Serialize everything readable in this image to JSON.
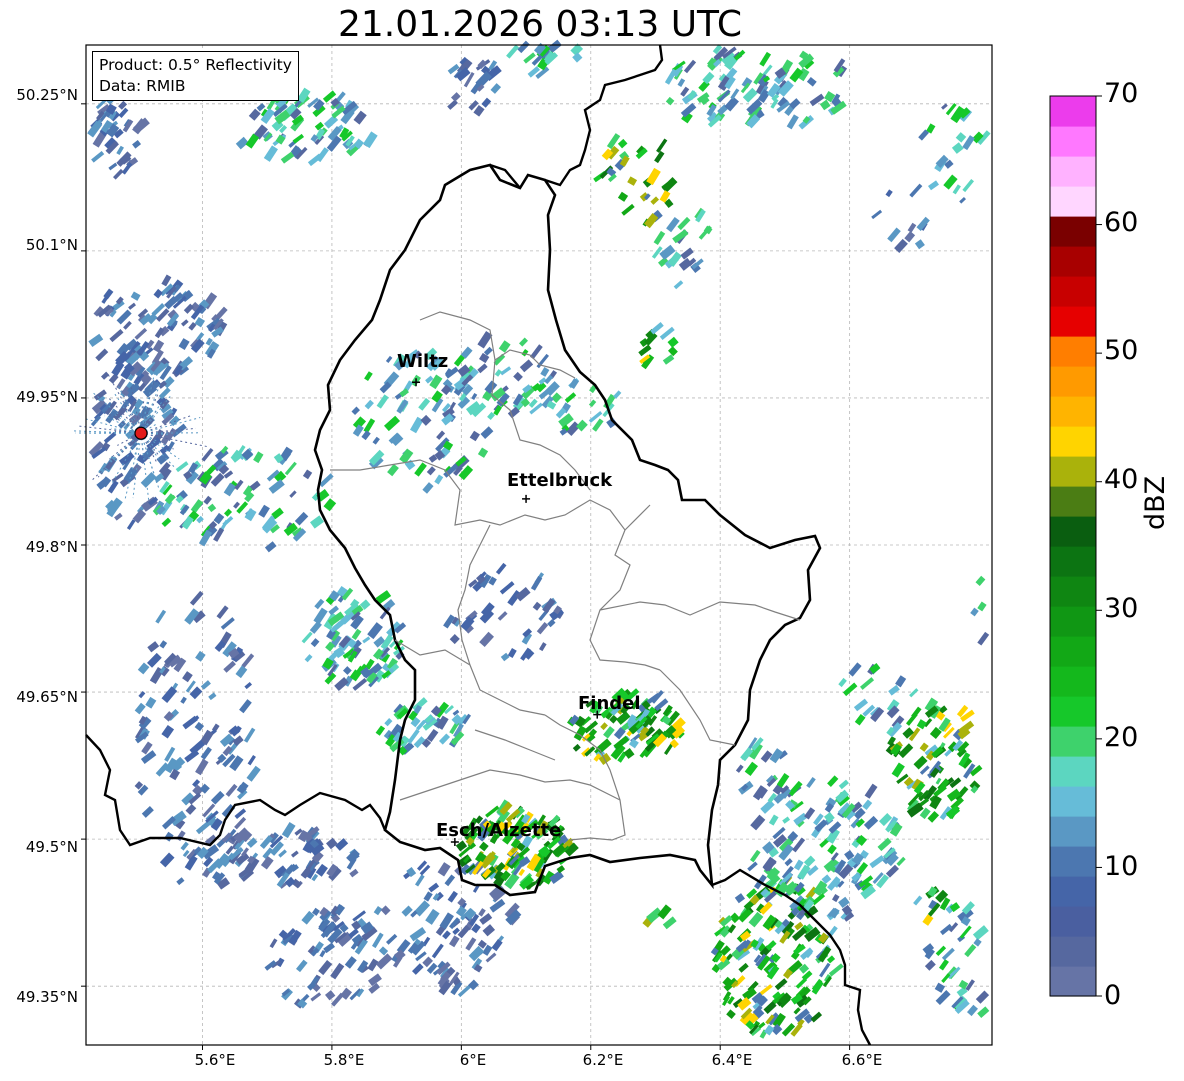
{
  "title": "21.01.2026 03:13 UTC",
  "info": {
    "product": "Product: 0.5° Reflectivity",
    "data": "Data: RMIB"
  },
  "map": {
    "lon_range": [
      5.42,
      6.82
    ],
    "lat_range": [
      49.29,
      50.31
    ],
    "lat_ticks": [
      {
        "value": 50.25,
        "label": "50.25°N"
      },
      {
        "value": 50.1,
        "label": "50.1°N"
      },
      {
        "value": 49.95,
        "label": "49.95°N"
      },
      {
        "value": 49.8,
        "label": "49.8°N"
      },
      {
        "value": 49.65,
        "label": "49.65°N"
      },
      {
        "value": 49.5,
        "label": "49.5°N"
      },
      {
        "value": 49.35,
        "label": "49.35°N"
      }
    ],
    "lon_ticks": [
      {
        "value": 5.6,
        "label": "5.6°E"
      },
      {
        "value": 5.8,
        "label": "5.8°E"
      },
      {
        "value": 6.0,
        "label": "6°E"
      },
      {
        "value": 6.2,
        "label": "6.2°E"
      },
      {
        "value": 6.4,
        "label": "6.4°E"
      },
      {
        "value": 6.6,
        "label": "6.6°E"
      }
    ],
    "radar_site": {
      "lon": 5.505,
      "lat": 49.914
    },
    "cities": [
      {
        "name": "Wiltz",
        "lon": 5.93,
        "lat": 49.966
      },
      {
        "name": "Ettelbruck",
        "lon": 6.1,
        "lat": 49.847
      },
      {
        "name": "Findel",
        "lon": 6.21,
        "lat": 49.627
      },
      {
        "name": "Esch/Alzette",
        "lon": 5.99,
        "lat": 49.497
      }
    ]
  },
  "colorbar": {
    "label": "dBZ",
    "ticks": [
      "0",
      "10",
      "20",
      "30",
      "40",
      "50",
      "60",
      "70"
    ],
    "min": 0,
    "max": 70,
    "colors": [
      "#6674a6",
      "#56689f",
      "#4a5fa0",
      "#4565a8",
      "#4c77b0",
      "#5a98c4",
      "#66bcd8",
      "#5cd6c0",
      "#3ed26c",
      "#16c82a",
      "#14b81c",
      "#12a816",
      "#109714",
      "#0f8612",
      "#0c7412",
      "#0a5e10",
      "#4b7d14",
      "#aab20b",
      "#ffd400",
      "#ffb400",
      "#ff9a00",
      "#ff7e00",
      "#e60000",
      "#c80000",
      "#a80000",
      "#7a0000",
      "#ffd6ff",
      "#ffb2ff",
      "#ff78ff",
      "#ec3cec"
    ]
  }
}
